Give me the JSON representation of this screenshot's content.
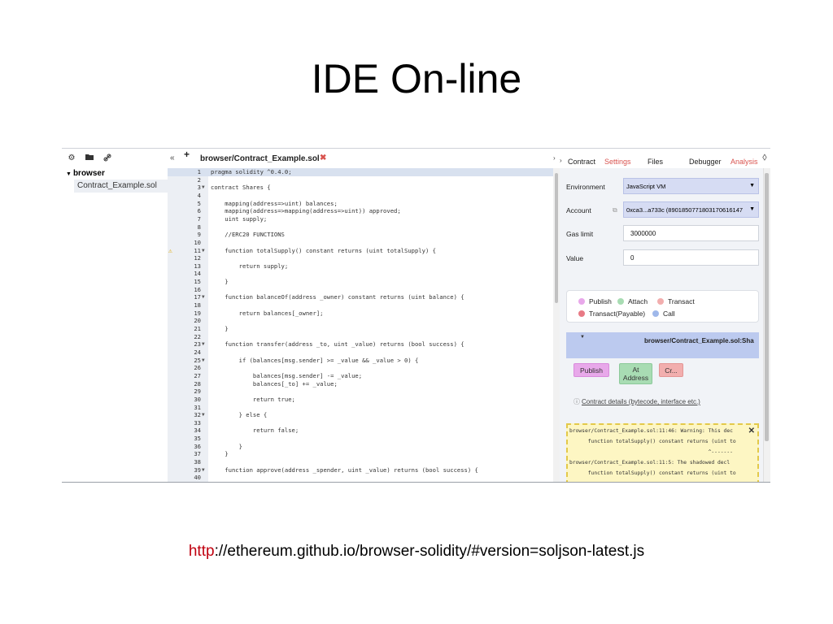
{
  "slide": {
    "title": "IDE On-line",
    "url_protocol": "http",
    "url_rest": "://ethereum.github.io/browser-solidity/#version=soljson-latest.js"
  },
  "explorer": {
    "tools": [
      "⚙",
      "📂",
      "🔗"
    ],
    "root_label": "browser",
    "file_label": "Contract_Example.sol"
  },
  "editor": {
    "nav_label": "«",
    "new_label": "+",
    "tab_label": "browser/Contract_Example.sol",
    "tab_close": "✖",
    "panel_toggle": "›",
    "lines": [
      {
        "n": "1",
        "t": "pragma solidity ^0.4.0;",
        "active": true
      },
      {
        "n": "2",
        "t": ""
      },
      {
        "n": "3",
        "t": "contract Shares {",
        "fold": true
      },
      {
        "n": "4",
        "t": ""
      },
      {
        "n": "5",
        "t": "    mapping(address=>uint) balances;"
      },
      {
        "n": "6",
        "t": "    mapping(address=>mapping(address=>uint)) approved;"
      },
      {
        "n": "7",
        "t": "    uint supply;"
      },
      {
        "n": "8",
        "t": ""
      },
      {
        "n": "9",
        "t": "    //ERC20 FUNCTIONS"
      },
      {
        "n": "10",
        "t": ""
      },
      {
        "n": "11",
        "t": "    function totalSupply() constant returns (uint totalSupply) {",
        "fold": true,
        "warn": true
      },
      {
        "n": "12",
        "t": ""
      },
      {
        "n": "13",
        "t": "        return supply;"
      },
      {
        "n": "14",
        "t": ""
      },
      {
        "n": "15",
        "t": "    }"
      },
      {
        "n": "16",
        "t": ""
      },
      {
        "n": "17",
        "t": "    function balanceOf(address _owner) constant returns (uint balance) {",
        "fold": true
      },
      {
        "n": "18",
        "t": ""
      },
      {
        "n": "19",
        "t": "        return balances[_owner];"
      },
      {
        "n": "20",
        "t": ""
      },
      {
        "n": "21",
        "t": "    }"
      },
      {
        "n": "22",
        "t": ""
      },
      {
        "n": "23",
        "t": "    function transfer(address _to, uint _value) returns (bool success) {",
        "fold": true
      },
      {
        "n": "24",
        "t": ""
      },
      {
        "n": "25",
        "t": "        if (balances[msg.sender] >= _value && _value > 0) {",
        "fold": true
      },
      {
        "n": "26",
        "t": ""
      },
      {
        "n": "27",
        "t": "            balances[msg.sender] -= _value;"
      },
      {
        "n": "28",
        "t": "            balances[_to] += _value;"
      },
      {
        "n": "29",
        "t": ""
      },
      {
        "n": "30",
        "t": "            return true;"
      },
      {
        "n": "31",
        "t": ""
      },
      {
        "n": "32",
        "t": "        } else {",
        "fold": true
      },
      {
        "n": "33",
        "t": ""
      },
      {
        "n": "34",
        "t": "            return false;"
      },
      {
        "n": "35",
        "t": ""
      },
      {
        "n": "36",
        "t": "        }"
      },
      {
        "n": "37",
        "t": "    }"
      },
      {
        "n": "38",
        "t": ""
      },
      {
        "n": "39",
        "t": "    function approve(address _spender, uint _value) returns (bool success) {",
        "fold": true
      },
      {
        "n": "40",
        "t": ""
      }
    ]
  },
  "right_panel": {
    "tabs": {
      "contract": "Contract",
      "settings": "Settings",
      "files": "Files",
      "debugger": "Debugger",
      "analysis": "Analysis"
    },
    "environment_label": "Environment",
    "environment_value": "JavaScript VM",
    "account_label": "Account",
    "account_value": "0xca3...a733c (8901850771803170616147",
    "gas_label": "Gas limit",
    "gas_value": "3000000",
    "value_label": "Value",
    "value_value": "0",
    "legend": {
      "publish": "Publish",
      "attach": "Attach",
      "transact": "Transact",
      "transact_payable": "Transact(Payable)",
      "call": "Call"
    },
    "contract_name": "browser/Contract_Example.sol:Sha",
    "buttons": {
      "publish": "Publish",
      "at_address_1": "At",
      "at_address_2": "Address",
      "create": "Cr..."
    },
    "details_link": "Contract details (bytecode, interface etc.)",
    "warnings": [
      "browser/Contract_Example.sol:11:46: Warning: This dec",
      "      function totalSupply() constant returns (uint to",
      "                                             ^-------",
      "browser/Contract_Example.sol:11:5: The shadowed decl",
      "      function totalSupply() constant returns (uint to"
    ],
    "colors": {
      "publish": "#e8a8ea",
      "attach": "#a8dcb3",
      "transact": "#f2aeae",
      "transact_payable": "#e87a85",
      "call": "#9fb8ea",
      "settings_tab": "#d9534f",
      "analysis_tab": "#d9534f"
    }
  }
}
